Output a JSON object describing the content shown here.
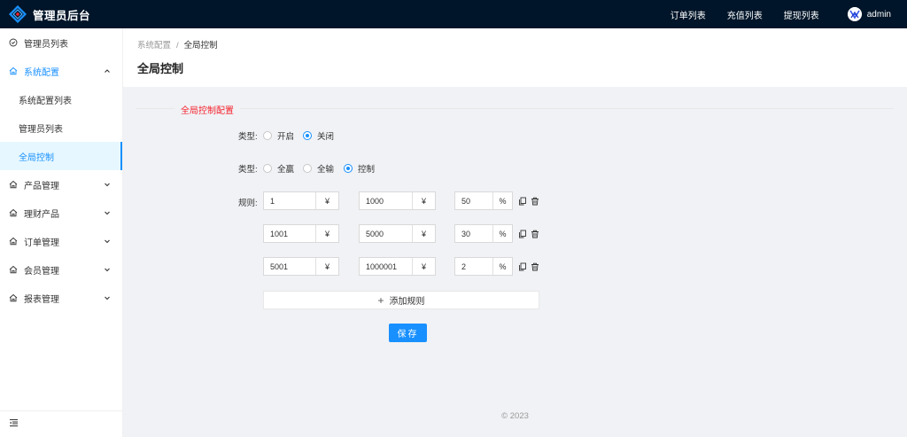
{
  "app": {
    "title": "管理员后台"
  },
  "top_nav": {
    "orders": "订单列表",
    "recharge": "充值列表",
    "withdraw": "提现列表"
  },
  "user": {
    "name": "admin"
  },
  "sidebar": {
    "admin_list": "管理员列表",
    "system_config": "系统配置",
    "system_config_items": [
      "系统配置列表",
      "管理员列表",
      "全局控制"
    ],
    "product_mgmt": "产品管理",
    "finance_products": "理财产品",
    "order_mgmt": "订单管理",
    "member_mgmt": "会员管理",
    "report_mgmt": "报表管理"
  },
  "breadcrumb": {
    "parent": "系统配置",
    "separator": "/",
    "current": "全局控制"
  },
  "page": {
    "title": "全局控制"
  },
  "section": {
    "title": "全局控制配置"
  },
  "form": {
    "type_label": "类型:",
    "switch_options": [
      "开启",
      "关闭"
    ],
    "switch_selected": "关闭",
    "mode_options": [
      "全赢",
      "全输",
      "控制"
    ],
    "mode_selected": "控制",
    "rule_label": "规则:",
    "rules": [
      {
        "min": "1",
        "max": "1000",
        "percent": "50"
      },
      {
        "min": "1001",
        "max": "5000",
        "percent": "30"
      },
      {
        "min": "5001",
        "max": "1000001",
        "percent": "2"
      }
    ],
    "currency_unit": "¥",
    "percent_unit": "%",
    "add_rule": "添加规则",
    "save": "保存"
  },
  "footer": {
    "text": "2023"
  },
  "colors": {
    "header_bg": "#001529",
    "primary": "#1890ff",
    "section_title": "#f5222d"
  }
}
